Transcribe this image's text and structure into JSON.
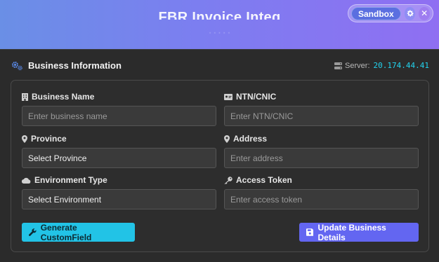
{
  "header": {
    "title": "FBR Invoice Integ",
    "subtitle": "· · · · ·",
    "environment_badge": "Sandbox"
  },
  "section": {
    "title": "Business Information",
    "server_label": "Server:",
    "server_ip": "20.174.44.41"
  },
  "form": {
    "business_name": {
      "label": "Business Name",
      "placeholder": "Enter business name"
    },
    "ntn_cnic": {
      "label": "NTN/CNIC",
      "placeholder": "Enter NTN/CNIC"
    },
    "province": {
      "label": "Province",
      "value": "Select Province"
    },
    "address": {
      "label": "Address",
      "placeholder": "Enter address"
    },
    "environment_type": {
      "label": "Environment Type",
      "value": "Select Environment"
    },
    "access_token": {
      "label": "Access Token",
      "placeholder": "Enter access token"
    }
  },
  "actions": {
    "generate_label": "Generate CustomField",
    "update_label": "Update Business Details"
  },
  "colors": {
    "accent_cyan": "#22c3e6",
    "accent_indigo": "#6366f1",
    "server_ip": "#22d3ee"
  }
}
